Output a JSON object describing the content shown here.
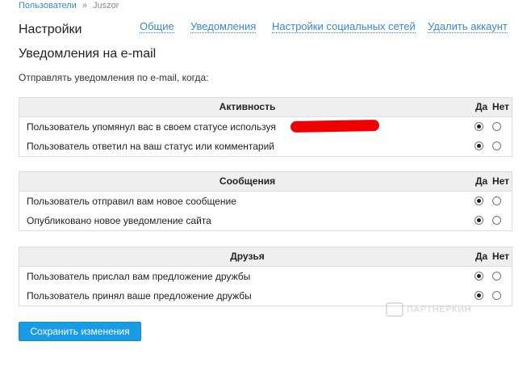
{
  "breadcrumb": {
    "parent": "Пользователи",
    "separator": "»",
    "current": "Juszor"
  },
  "page_title": "Настройки",
  "tabs": [
    {
      "label": "Общие"
    },
    {
      "label": "Уведомления"
    },
    {
      "label": "Настройки социальных сетей"
    },
    {
      "label": "Удалить аккаунт"
    }
  ],
  "section_title": "Уведомления на e-mail",
  "intro": "Отправлять уведомления по e-mail, когда:",
  "columns": {
    "yes": "Да",
    "no": "Нет"
  },
  "groups": [
    {
      "title": "Активность",
      "rows": [
        {
          "label": "Пользователь упомянул вас в своем статусе используя",
          "value": "yes"
        },
        {
          "label": "Пользователь ответил на ваш статус или комментарий",
          "value": "yes"
        }
      ]
    },
    {
      "title": "Сообщения",
      "rows": [
        {
          "label": "Пользователь отправил вам новое сообщение",
          "value": "yes"
        },
        {
          "label": "Опубликовано новое уведомление сайта",
          "value": "yes"
        }
      ]
    },
    {
      "title": "Друзья",
      "rows": [
        {
          "label": "Пользователь прислал вам предложение дружбы",
          "value": "yes"
        },
        {
          "label": "Пользователь принял ваше предложение дружбы",
          "value": "yes"
        }
      ]
    }
  ],
  "save_button": "Сохранить изменения",
  "watermark": "ПАРТНЕРКИН",
  "colors": {
    "link": "#3a87c8",
    "button": "#1a9be6",
    "header_bg": "#efefef",
    "redaction": "#f00000"
  }
}
